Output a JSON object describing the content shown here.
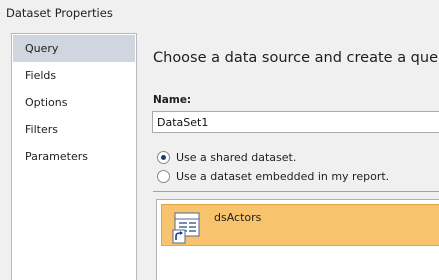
{
  "window": {
    "title": "Dataset Properties"
  },
  "nav": {
    "items": [
      {
        "label": "Query",
        "selected": true
      },
      {
        "label": "Fields",
        "selected": false
      },
      {
        "label": "Options",
        "selected": false
      },
      {
        "label": "Filters",
        "selected": false
      },
      {
        "label": "Parameters",
        "selected": false
      }
    ]
  },
  "main": {
    "heading": "Choose a data source and create a query.",
    "name_label": "Name:",
    "name_value": "DataSet1",
    "radio_shared": {
      "label": "Use a shared dataset.",
      "checked": true
    },
    "radio_embedded": {
      "label": "Use a dataset embedded in my report.",
      "checked": false
    },
    "datasets": [
      {
        "label": "dsActors",
        "icon": "shared-dataset-icon"
      }
    ]
  },
  "colors": {
    "selected_nav_bg": "#cfd6df",
    "selected_item_bg": "#f7c36c",
    "window_bg": "#f0f0f0"
  }
}
